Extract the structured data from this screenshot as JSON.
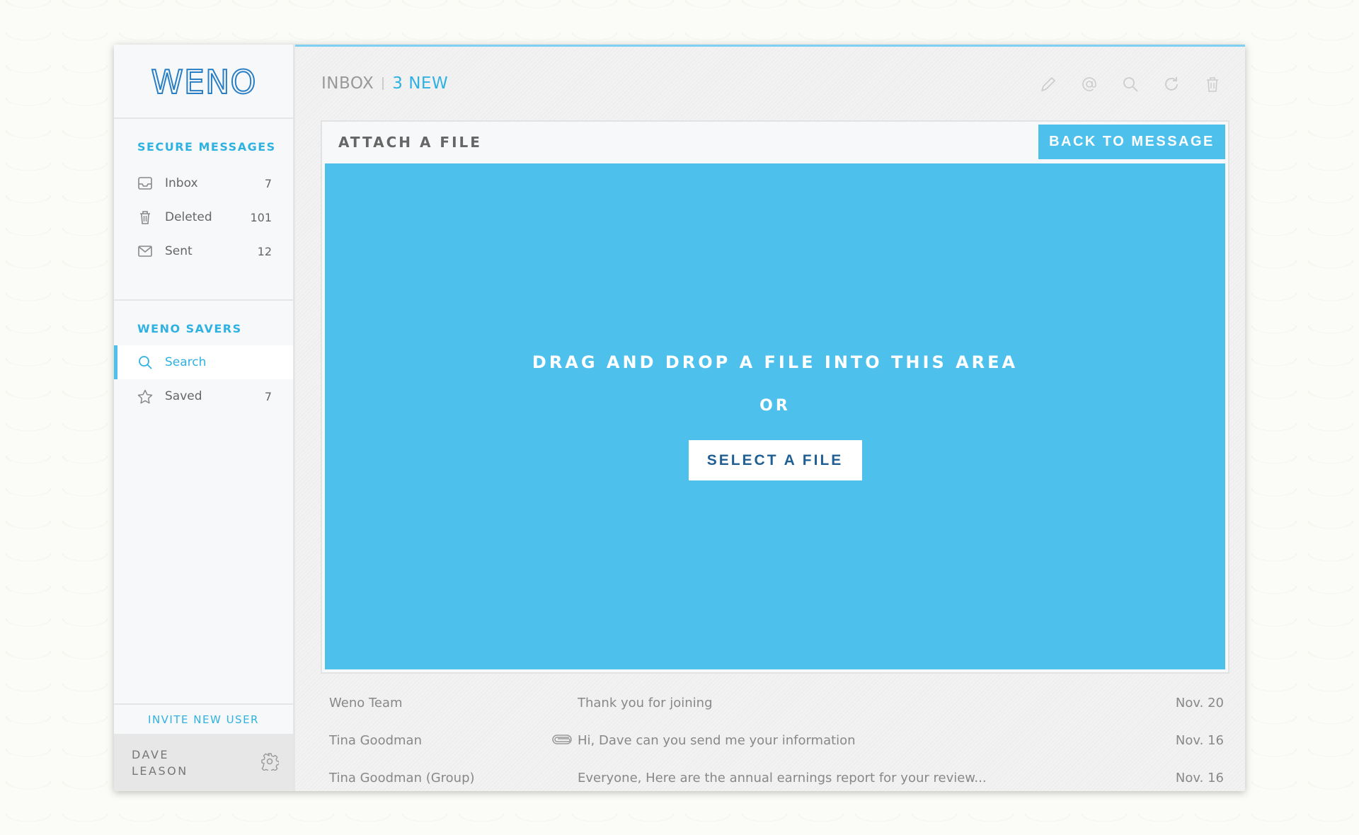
{
  "logo": "WENO",
  "colors": {
    "accent": "#4ec0ec",
    "accent_text": "#2fb1e2",
    "button_text": "#1f5f94"
  },
  "sidebar": {
    "secure_title": "SECURE MESSAGES",
    "secure_items": [
      {
        "label": "Inbox",
        "count": "7",
        "icon": "inbox-icon"
      },
      {
        "label": "Deleted",
        "count": "101",
        "icon": "trash-icon"
      },
      {
        "label": "Sent",
        "count": "12",
        "icon": "envelope-icon"
      }
    ],
    "savers_title": "WENO SAVERS",
    "savers_items": [
      {
        "label": "Search",
        "count": "",
        "icon": "search-icon",
        "active": true
      },
      {
        "label": "Saved",
        "count": "7",
        "icon": "star-icon"
      }
    ],
    "invite_label": "INVITE NEW USER",
    "user_name_line1": "DAVE",
    "user_name_line2": "LEASON"
  },
  "header": {
    "inbox_label": "INBOX",
    "new_label": "3 NEW",
    "tools": [
      "compose-icon",
      "at-icon",
      "search-icon",
      "refresh-icon",
      "trash-icon"
    ]
  },
  "panel": {
    "title": "ATTACH A FILE",
    "back_label": "BACK TO MESSAGE",
    "dropzone_text": "DRAG AND DROP A FILE INTO THIS AREA",
    "or_text": "OR",
    "select_label": "SELECT A FILE"
  },
  "messages": [
    {
      "from": "Weno Team",
      "subject": "Thank you for joining",
      "date": "Nov. 20",
      "attachment": false
    },
    {
      "from": "Tina Goodman",
      "subject": "Hi, Dave can you send me your information",
      "date": "Nov. 16",
      "attachment": true
    },
    {
      "from": "Tina Goodman (Group)",
      "subject": "Everyone, Here are the annual earnings report for your review...",
      "date": "Nov. 16",
      "attachment": false
    }
  ]
}
